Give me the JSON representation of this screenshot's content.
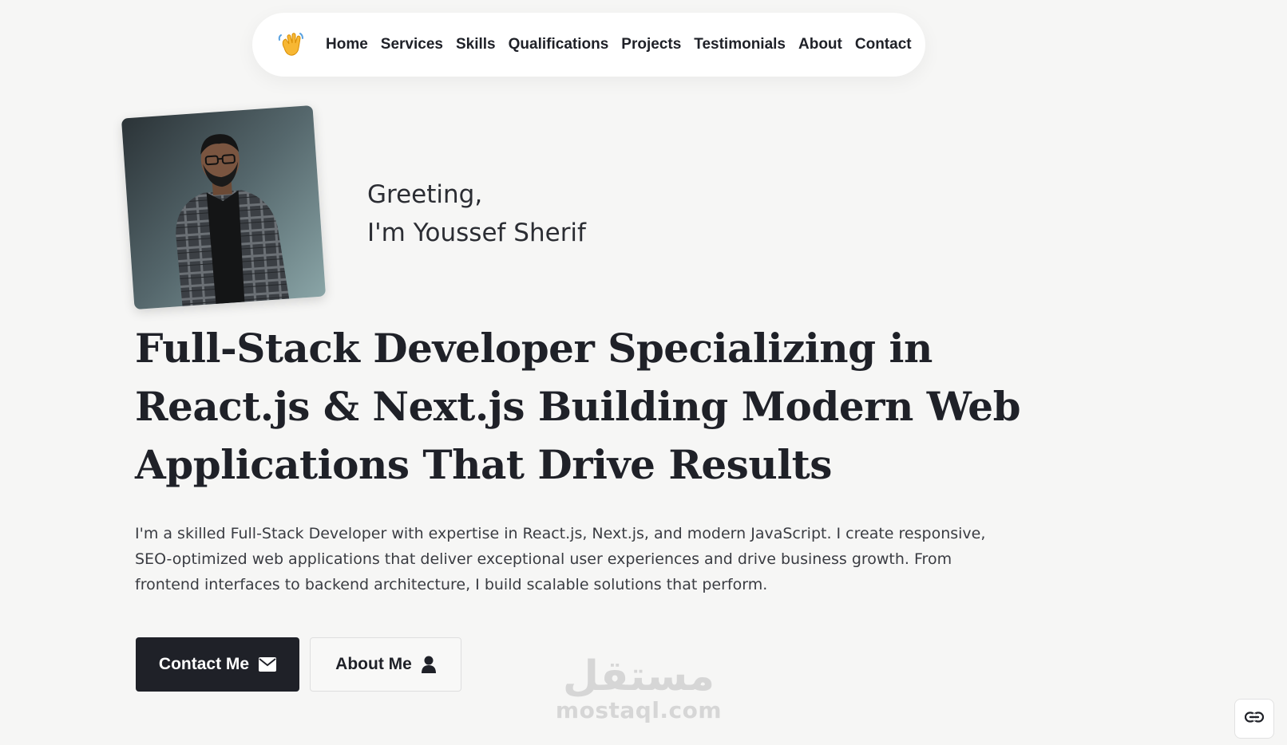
{
  "nav": {
    "logo_icon": "waving-hand-icon",
    "links": [
      {
        "label": "Home"
      },
      {
        "label": "Services"
      },
      {
        "label": "Skills"
      },
      {
        "label": "Qualifications"
      },
      {
        "label": "Projects"
      },
      {
        "label": "Testimonials"
      },
      {
        "label": "About"
      },
      {
        "label": "Contact"
      }
    ]
  },
  "hero": {
    "greeting_line1": "Greeting,",
    "greeting_line2": "I'm Youssef Sherif",
    "headline": "Full-Stack Developer Specializing in React.js & Next.js Building Modern Web Applications That Drive Results",
    "intro": "I'm a skilled Full-Stack Developer with expertise in React.js, Next.js, and modern JavaScript. I create responsive, SEO-optimized web applications that deliver exceptional user experiences and drive business growth. From frontend interfaces to backend architecture, I build scalable solutions that perform.",
    "buttons": {
      "contact_label": "Contact Me",
      "contact_icon": "envelope-icon",
      "about_label": "About Me",
      "about_icon": "user-icon"
    }
  },
  "watermark": {
    "arabic": "مستقل",
    "latin": "mostaql.com"
  },
  "floating": {
    "link_icon": "link-icon"
  },
  "colors": {
    "background": "#f6f6f5",
    "text": "#1f2128",
    "primary_button": "#1f2128",
    "nav_background": "#ffffff"
  }
}
